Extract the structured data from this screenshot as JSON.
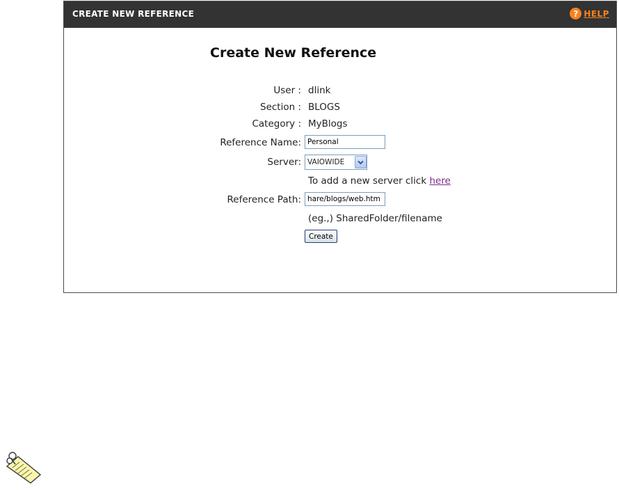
{
  "panel": {
    "title": "CREATE NEW REFERENCE",
    "help_label": "HELP",
    "help_glyph": "?"
  },
  "form": {
    "heading": "Create New Reference",
    "user": {
      "label": "User :",
      "value": "dlink"
    },
    "section": {
      "label": "Section :",
      "value": "BLOGS"
    },
    "category": {
      "label": "Category :",
      "value": "MyBlogs"
    },
    "reference_name": {
      "label": "Reference Name:",
      "value": "Personal"
    },
    "server": {
      "label": "Server:",
      "value": "VAIOWIDE"
    },
    "add_server_hint": {
      "text": "To add a new server click ",
      "link": "here"
    },
    "reference_path": {
      "label": "Reference Path:",
      "value": "hare/blogs/web.htm"
    },
    "path_example": "(eg.,) SharedFolder/filename",
    "create_label": "Create"
  },
  "icons": {
    "help": "help-icon",
    "dropdown": "chevron-down-icon",
    "note": "note-icon"
  },
  "colors": {
    "titlebar": "#333333",
    "help_accent": "#f58220",
    "link": "#7d2b8b"
  }
}
